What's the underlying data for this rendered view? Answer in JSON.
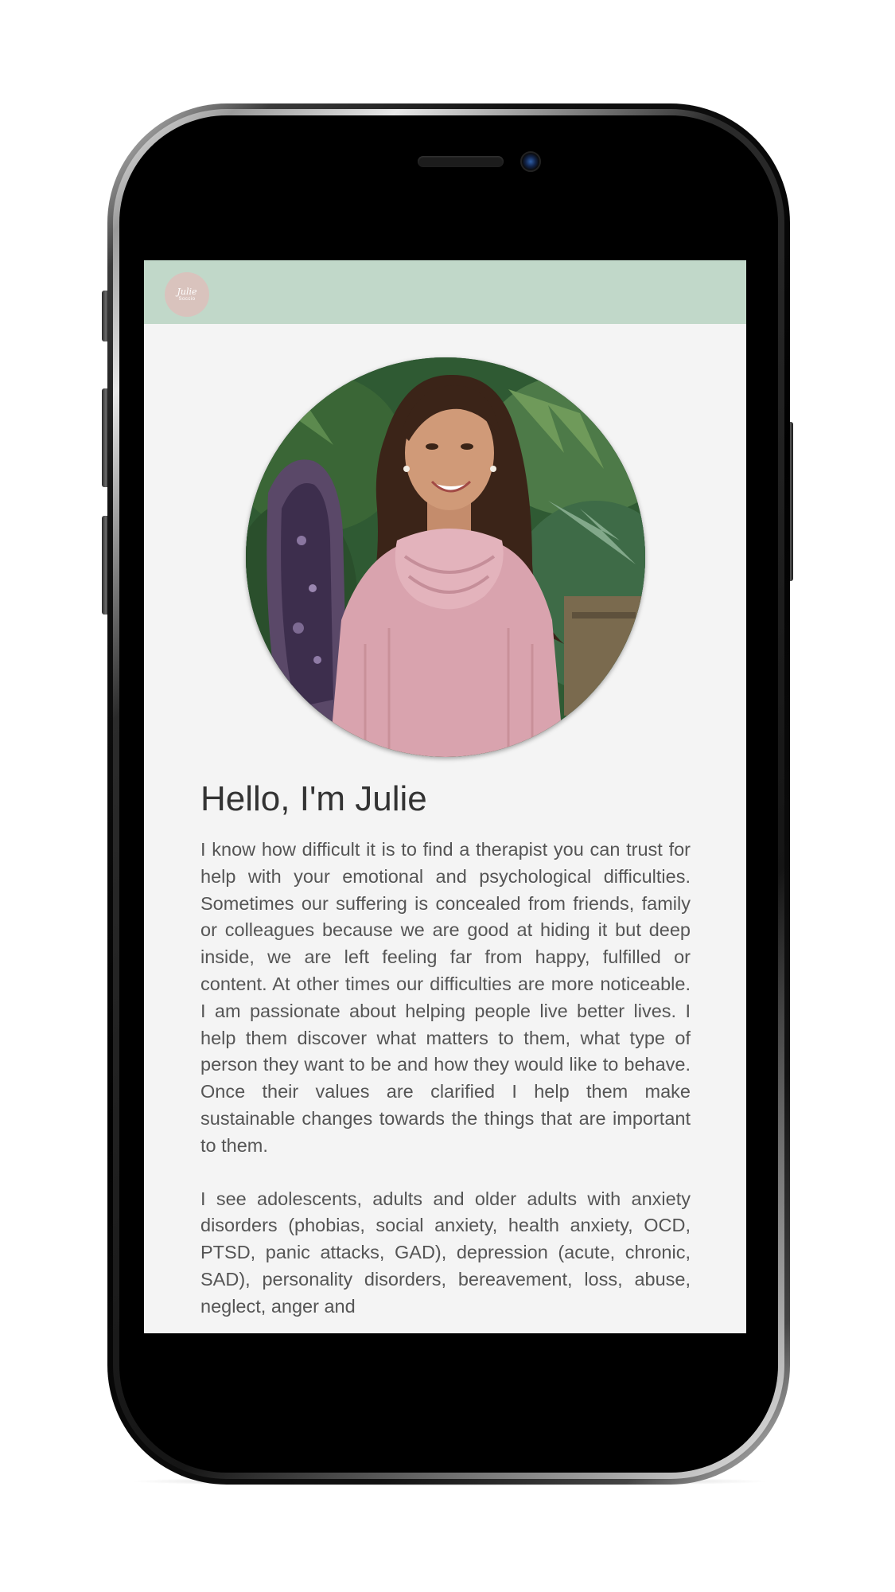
{
  "site": {
    "logo": {
      "name": "Julie",
      "sub": "Soccio"
    }
  },
  "about": {
    "title": "Hello, I'm Julie",
    "paragraphs": [
      "I know how difficult it is to find a therapist you can trust for help with your emotional and psychological difficulties. Sometimes our suffering is concealed from friends, family or colleagues because we are good at hiding it but deep inside, we are left feeling far from happy, fulfilled or content. At other times our difficulties are more noticeable. I am passionate about helping people live better lives. I help them discover what matters to them, what type of person they want to be and how they would like to behave. Once their values are clarified I help them make sustainable changes towards the things that are important to them.",
      "I see adolescents, adults and older adults with anxiety disorders (phobias, social anxiety, health anxiety, OCD, PTSD, panic attacks, GAD), depression (acute, chronic, SAD), personality disorders, bereavement, loss, abuse, neglect, anger and"
    ]
  },
  "colors": {
    "header": "#c1d8c9",
    "page_background": "#f4f4f4",
    "logo_badge": "#d9c3bd",
    "heading_text": "#333333",
    "body_text": "#555555"
  },
  "icons": {
    "profile_photo": "portrait-photo"
  }
}
